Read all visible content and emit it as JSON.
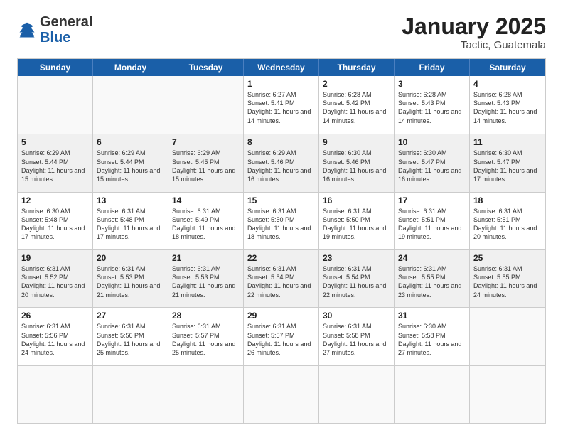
{
  "logo": {
    "general": "General",
    "blue": "Blue"
  },
  "header": {
    "month": "January 2025",
    "location": "Tactic, Guatemala"
  },
  "weekdays": [
    "Sunday",
    "Monday",
    "Tuesday",
    "Wednesday",
    "Thursday",
    "Friday",
    "Saturday"
  ],
  "rows": [
    [
      {
        "day": "",
        "info": "",
        "empty": true
      },
      {
        "day": "",
        "info": "",
        "empty": true
      },
      {
        "day": "",
        "info": "",
        "empty": true
      },
      {
        "day": "1",
        "info": "Sunrise: 6:27 AM\nSunset: 5:41 PM\nDaylight: 11 hours\nand 14 minutes."
      },
      {
        "day": "2",
        "info": "Sunrise: 6:28 AM\nSunset: 5:42 PM\nDaylight: 11 hours\nand 14 minutes."
      },
      {
        "day": "3",
        "info": "Sunrise: 6:28 AM\nSunset: 5:43 PM\nDaylight: 11 hours\nand 14 minutes."
      },
      {
        "day": "4",
        "info": "Sunrise: 6:28 AM\nSunset: 5:43 PM\nDaylight: 11 hours\nand 14 minutes."
      }
    ],
    [
      {
        "day": "5",
        "info": "Sunrise: 6:29 AM\nSunset: 5:44 PM\nDaylight: 11 hours\nand 15 minutes."
      },
      {
        "day": "6",
        "info": "Sunrise: 6:29 AM\nSunset: 5:44 PM\nDaylight: 11 hours\nand 15 minutes."
      },
      {
        "day": "7",
        "info": "Sunrise: 6:29 AM\nSunset: 5:45 PM\nDaylight: 11 hours\nand 15 minutes."
      },
      {
        "day": "8",
        "info": "Sunrise: 6:29 AM\nSunset: 5:46 PM\nDaylight: 11 hours\nand 16 minutes."
      },
      {
        "day": "9",
        "info": "Sunrise: 6:30 AM\nSunset: 5:46 PM\nDaylight: 11 hours\nand 16 minutes."
      },
      {
        "day": "10",
        "info": "Sunrise: 6:30 AM\nSunset: 5:47 PM\nDaylight: 11 hours\nand 16 minutes."
      },
      {
        "day": "11",
        "info": "Sunrise: 6:30 AM\nSunset: 5:47 PM\nDaylight: 11 hours\nand 17 minutes."
      }
    ],
    [
      {
        "day": "12",
        "info": "Sunrise: 6:30 AM\nSunset: 5:48 PM\nDaylight: 11 hours\nand 17 minutes."
      },
      {
        "day": "13",
        "info": "Sunrise: 6:31 AM\nSunset: 5:48 PM\nDaylight: 11 hours\nand 17 minutes."
      },
      {
        "day": "14",
        "info": "Sunrise: 6:31 AM\nSunset: 5:49 PM\nDaylight: 11 hours\nand 18 minutes."
      },
      {
        "day": "15",
        "info": "Sunrise: 6:31 AM\nSunset: 5:50 PM\nDaylight: 11 hours\nand 18 minutes."
      },
      {
        "day": "16",
        "info": "Sunrise: 6:31 AM\nSunset: 5:50 PM\nDaylight: 11 hours\nand 19 minutes."
      },
      {
        "day": "17",
        "info": "Sunrise: 6:31 AM\nSunset: 5:51 PM\nDaylight: 11 hours\nand 19 minutes."
      },
      {
        "day": "18",
        "info": "Sunrise: 6:31 AM\nSunset: 5:51 PM\nDaylight: 11 hours\nand 20 minutes."
      }
    ],
    [
      {
        "day": "19",
        "info": "Sunrise: 6:31 AM\nSunset: 5:52 PM\nDaylight: 11 hours\nand 20 minutes."
      },
      {
        "day": "20",
        "info": "Sunrise: 6:31 AM\nSunset: 5:53 PM\nDaylight: 11 hours\nand 21 minutes."
      },
      {
        "day": "21",
        "info": "Sunrise: 6:31 AM\nSunset: 5:53 PM\nDaylight: 11 hours\nand 21 minutes."
      },
      {
        "day": "22",
        "info": "Sunrise: 6:31 AM\nSunset: 5:54 PM\nDaylight: 11 hours\nand 22 minutes."
      },
      {
        "day": "23",
        "info": "Sunrise: 6:31 AM\nSunset: 5:54 PM\nDaylight: 11 hours\nand 22 minutes."
      },
      {
        "day": "24",
        "info": "Sunrise: 6:31 AM\nSunset: 5:55 PM\nDaylight: 11 hours\nand 23 minutes."
      },
      {
        "day": "25",
        "info": "Sunrise: 6:31 AM\nSunset: 5:55 PM\nDaylight: 11 hours\nand 24 minutes."
      }
    ],
    [
      {
        "day": "26",
        "info": "Sunrise: 6:31 AM\nSunset: 5:56 PM\nDaylight: 11 hours\nand 24 minutes."
      },
      {
        "day": "27",
        "info": "Sunrise: 6:31 AM\nSunset: 5:56 PM\nDaylight: 11 hours\nand 25 minutes."
      },
      {
        "day": "28",
        "info": "Sunrise: 6:31 AM\nSunset: 5:57 PM\nDaylight: 11 hours\nand 25 minutes."
      },
      {
        "day": "29",
        "info": "Sunrise: 6:31 AM\nSunset: 5:57 PM\nDaylight: 11 hours\nand 26 minutes."
      },
      {
        "day": "30",
        "info": "Sunrise: 6:31 AM\nSunset: 5:58 PM\nDaylight: 11 hours\nand 27 minutes."
      },
      {
        "day": "31",
        "info": "Sunrise: 6:30 AM\nSunset: 5:58 PM\nDaylight: 11 hours\nand 27 minutes."
      },
      {
        "day": "",
        "info": "",
        "empty": true
      }
    ],
    [
      {
        "day": "",
        "info": "",
        "empty": true
      },
      {
        "day": "",
        "info": "",
        "empty": true
      },
      {
        "day": "",
        "info": "",
        "empty": true
      },
      {
        "day": "",
        "info": "",
        "empty": true
      },
      {
        "day": "",
        "info": "",
        "empty": true
      },
      {
        "day": "",
        "info": "",
        "empty": true
      },
      {
        "day": "",
        "info": "",
        "empty": true
      }
    ]
  ]
}
